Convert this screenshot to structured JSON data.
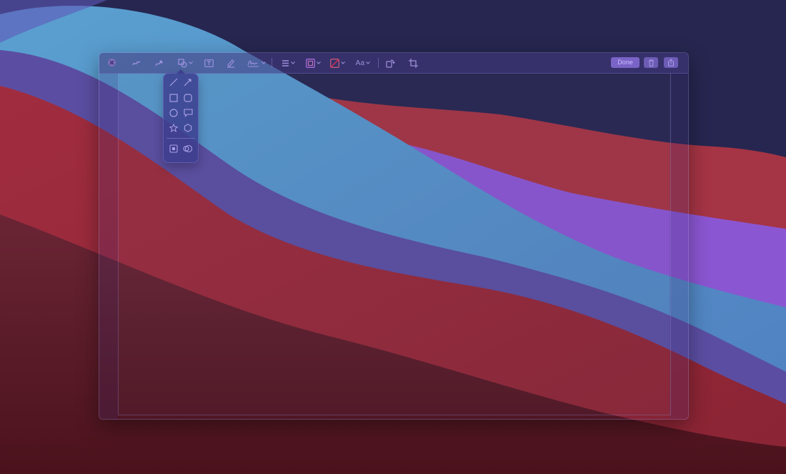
{
  "colors": {
    "accent": "#7a63c7",
    "icon": "#9c90da",
    "done_text": "#c9bcff",
    "toolbar_bg": "#3f3a7a"
  },
  "toolbar": {
    "close": {
      "icon": "close-icon"
    },
    "sketch": {
      "icon": "sketch-icon"
    },
    "draw": {
      "icon": "draw-icon"
    },
    "shapes": {
      "icon": "shapes-icon",
      "has_menu": true
    },
    "text": {
      "icon": "text-box-icon"
    },
    "highlight": {
      "icon": "highlight-icon"
    },
    "sign": {
      "icon": "signature-icon",
      "has_menu": true
    },
    "line_style": {
      "icon": "line-style-icon",
      "has_menu": true
    },
    "border_color": {
      "icon": "border-color-icon",
      "has_menu": true
    },
    "fill_color": {
      "icon": "fill-color-icon",
      "has_menu": true
    },
    "text_style": {
      "label": "Aa",
      "has_menu": true
    },
    "rotate": {
      "icon": "rotate-icon"
    },
    "crop": {
      "icon": "crop-icon"
    },
    "done_label": "Done",
    "delete": {
      "icon": "trash-icon"
    },
    "share": {
      "icon": "share-icon"
    }
  },
  "shapes_menu": {
    "items": [
      {
        "name": "line",
        "icon": "line-icon"
      },
      {
        "name": "arrow",
        "icon": "arrow-icon"
      },
      {
        "name": "rectangle",
        "icon": "rectangle-icon"
      },
      {
        "name": "rounded-rectangle",
        "icon": "rounded-rectangle-icon"
      },
      {
        "name": "oval",
        "icon": "oval-icon"
      },
      {
        "name": "speech-bubble",
        "icon": "speech-bubble-icon"
      },
      {
        "name": "star",
        "icon": "star-icon"
      },
      {
        "name": "hexagon",
        "icon": "hexagon-icon"
      },
      {
        "name": "mask",
        "icon": "mask-icon"
      },
      {
        "name": "loupe",
        "icon": "loupe-icon"
      }
    ]
  }
}
